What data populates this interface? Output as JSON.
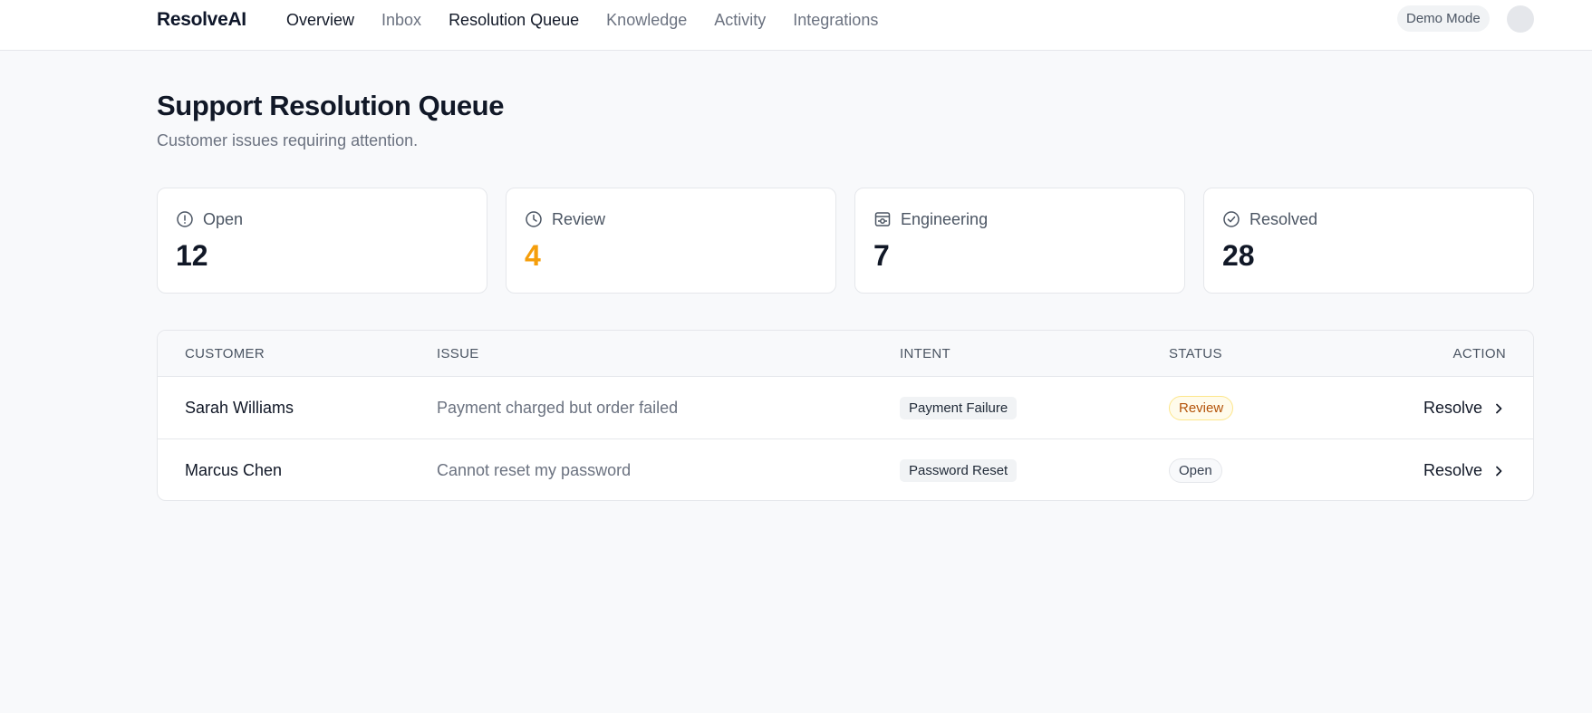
{
  "app": {
    "brand": "ResolveAI"
  },
  "nav": {
    "items": [
      {
        "label": "Overview"
      },
      {
        "label": "Inbox"
      },
      {
        "label": "Resolution Queue"
      },
      {
        "label": "Knowledge"
      },
      {
        "label": "Activity"
      },
      {
        "label": "Integrations"
      }
    ],
    "active": [
      "Overview",
      "Resolution Queue"
    ]
  },
  "header": {
    "demo_badge": "Demo Mode"
  },
  "page": {
    "title": "Support Resolution Queue",
    "subtitle": "Customer issues requiring attention."
  },
  "stats": [
    {
      "label": "Open",
      "value": "12",
      "icon": "alert-circle-icon"
    },
    {
      "label": "Review",
      "value": "4",
      "icon": "clock-icon",
      "color": "#f59e0b"
    },
    {
      "label": "Engineering",
      "value": "7",
      "icon": "server-icon"
    },
    {
      "label": "Resolved",
      "value": "28",
      "icon": "check-circle-icon"
    }
  ],
  "table": {
    "headers": [
      "CUSTOMER",
      "ISSUE",
      "INTENT",
      "STATUS",
      "ACTION"
    ],
    "rows": [
      {
        "customer": "Sarah Williams",
        "issue": "Payment charged but order failed",
        "intent": "Payment Failure",
        "status": "Review",
        "action": "Resolve"
      },
      {
        "customer": "Marcus Chen",
        "issue": "Cannot reset my password",
        "intent": "Password Reset",
        "status": "Open",
        "action": "Resolve"
      }
    ]
  },
  "colors": {
    "accent_warning": "#f59e0b",
    "border": "#e5e7eb",
    "background": "#f8f9fb"
  }
}
